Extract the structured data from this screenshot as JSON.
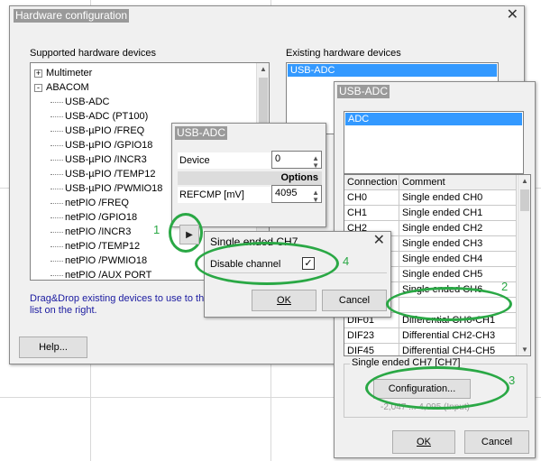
{
  "hw": {
    "title": "Hardware configuration",
    "supported_label": "Supported hardware devices",
    "existing_label": "Existing hardware devices",
    "tree": [
      {
        "label": "Multimeter",
        "toggle": "+"
      },
      {
        "label": "ABACOM",
        "toggle": "-"
      },
      {
        "label": "USB-ADC"
      },
      {
        "label": "USB-ADC (PT100)"
      },
      {
        "label": "USB-µPIO /FREQ"
      },
      {
        "label": "USB-µPIO /GPIO18"
      },
      {
        "label": "USB-µPIO /INCR3"
      },
      {
        "label": "USB-µPIO /TEMP12"
      },
      {
        "label": "USB-µPIO /PWMIO18"
      },
      {
        "label": "netPIO /FREQ"
      },
      {
        "label": "netPIO /GPIO18"
      },
      {
        "label": "netPIO /INCR3"
      },
      {
        "label": "netPIO /TEMP12"
      },
      {
        "label": "netPIO /PWMIO18"
      },
      {
        "label": "netPIO /AUX PORT"
      }
    ],
    "existing_items": [
      "USB-ADC"
    ],
    "hint": "Drag&Drop existing devices to use to the list on the right.",
    "help_button": "Help..."
  },
  "usbadc": {
    "title": "USB-ADC",
    "device_label": "Device",
    "device_value": "0",
    "options_header": "Options",
    "refcmp_label": "REFCMP [mV]",
    "refcmp_value": "4095"
  },
  "channel": {
    "title": "Single ended CH7",
    "disable_label": "Disable channel",
    "disable_checked": "✓",
    "ok": "OK",
    "cancel": "Cancel"
  },
  "aux": {
    "title": "USB-ADC",
    "list_items": [
      "ADC"
    ],
    "col_connection": "Connection",
    "col_comment": "Comment",
    "rows": [
      {
        "conn": "CH0",
        "comment": "Single ended CH0"
      },
      {
        "conn": "CH1",
        "comment": "Single ended CH1"
      },
      {
        "conn": "CH2",
        "comment": "Single ended CH2"
      },
      {
        "conn": "CH3",
        "comment": "Single ended CH3"
      },
      {
        "conn": "CH4",
        "comment": "Single ended CH4"
      },
      {
        "conn": "CH5",
        "comment": "Single ended CH5"
      },
      {
        "conn": "CH6",
        "comment": "Single ended CH6"
      },
      {
        "conn": "CH7",
        "comment": "Single ended CH7"
      },
      {
        "conn": "DIF01",
        "comment": "Differential CH0-CH1"
      },
      {
        "conn": "DIF23",
        "comment": "Differential CH2-CH3"
      },
      {
        "conn": "DIF45",
        "comment": "Differential CH4-CH5"
      }
    ],
    "group_label": "Single ended CH7 [CH7]",
    "config_button": "Configuration...",
    "range_text": "-2,047 ... 4,095 (Input)",
    "ok": "OK",
    "cancel": "Cancel"
  },
  "annotations": {
    "n1": "1",
    "n2": "2",
    "n3": "3",
    "n4": "4"
  },
  "colors": {
    "accent": "#3399ff",
    "annotation": "#2aa845"
  }
}
